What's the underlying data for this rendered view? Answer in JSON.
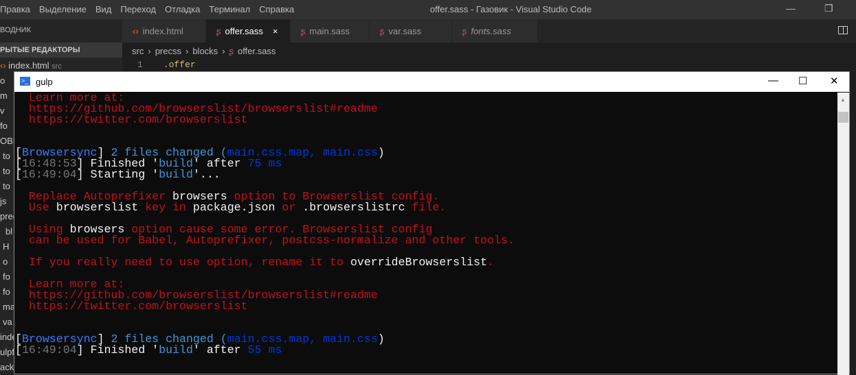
{
  "window": {
    "title": "offer.sass - Газовик - Visual Studio Code",
    "minimize": "—",
    "restore": "❐"
  },
  "menu": [
    "Правка",
    "Выделение",
    "Вид",
    "Переход",
    "Отладка",
    "Терминал",
    "Справка"
  ],
  "sidebar": {
    "header": "ВОДНИК",
    "section": "РЫТЫЕ РЕДАКТОРЫ",
    "open_editor": "index.html",
    "open_editor_dir": "src",
    "fragments": [
      "o",
      "m",
      "v",
      "fo",
      "ОВИ",
      "to",
      "to",
      "to",
      "js",
      "prec",
      "bl",
      "H",
      "o",
      "fo",
      "fo",
      "ma",
      "va",
      "inde",
      "ulpf",
      "ackage-lock.json"
    ]
  },
  "tabs": [
    {
      "label": "index.html",
      "icon": "html-icon"
    },
    {
      "label": "offer.sass",
      "icon": "sass-icon",
      "active": true,
      "close": "×"
    },
    {
      "label": "main.sass",
      "icon": "sass-icon"
    },
    {
      "label": "var.sass",
      "icon": "sass-icon"
    },
    {
      "label": "fonts.sass",
      "icon": "sass-icon",
      "italic": true
    }
  ],
  "breadcrumb": [
    "src",
    "precss",
    "blocks",
    "offer.sass"
  ],
  "editor": {
    "line_number": "1",
    "code": ".offer"
  },
  "terminal": {
    "title": "gulp",
    "minimize": "—",
    "maximize": "☐",
    "close": "✕",
    "lines": [
      [
        [
          "  Learn more at:",
          "red"
        ]
      ],
      [
        [
          "  https://github.com/browserslist/browserslist#readme",
          "red"
        ]
      ],
      [
        [
          "  https://twitter.com/browserslist",
          "red"
        ]
      ],
      [],
      [],
      [
        [
          "[",
          "white"
        ],
        [
          "Browsersync",
          "blue"
        ],
        [
          "] ",
          "white"
        ],
        [
          "2 files changed (",
          "lblue"
        ],
        [
          "main.css.map, main.css",
          "dblue"
        ],
        [
          ")",
          "white"
        ]
      ],
      [
        [
          "[",
          "white"
        ],
        [
          "16:48:53",
          "gray"
        ],
        [
          "] Finished '",
          "white"
        ],
        [
          "build",
          "lblue"
        ],
        [
          "' after ",
          "white"
        ],
        [
          "75 ms",
          "dblue"
        ]
      ],
      [
        [
          "[",
          "white"
        ],
        [
          "16:49:04",
          "gray"
        ],
        [
          "] Starting '",
          "white"
        ],
        [
          "build",
          "lblue"
        ],
        [
          "'...",
          "white"
        ]
      ],
      [],
      [
        [
          "  Replace Autoprefixer ",
          "red"
        ],
        [
          "browsers",
          "white"
        ],
        [
          " option to Browserslist config.",
          "red"
        ]
      ],
      [
        [
          "  Use ",
          "red"
        ],
        [
          "browserslist",
          "white"
        ],
        [
          " key in ",
          "red"
        ],
        [
          "package.json",
          "white"
        ],
        [
          " or ",
          "red"
        ],
        [
          ".browserslistrc",
          "white"
        ],
        [
          " file.",
          "red"
        ]
      ],
      [],
      [
        [
          "  Using ",
          "red"
        ],
        [
          "browsers",
          "white"
        ],
        [
          " option cause some error. Browserslist config",
          "red"
        ]
      ],
      [
        [
          "  can be used for Babel, Autoprefixer, postcss-normalize and other tools.",
          "red"
        ]
      ],
      [],
      [
        [
          "  If you really need to use option, rename it to ",
          "red"
        ],
        [
          "overrideBrowserslist",
          "white"
        ],
        [
          ".",
          "red"
        ]
      ],
      [],
      [
        [
          "  Learn more at:",
          "red"
        ]
      ],
      [
        [
          "  https://github.com/browserslist/browserslist#readme",
          "red"
        ]
      ],
      [
        [
          "  https://twitter.com/browserslist",
          "red"
        ]
      ],
      [],
      [],
      [
        [
          "[",
          "white"
        ],
        [
          "Browsersync",
          "blue"
        ],
        [
          "] ",
          "white"
        ],
        [
          "2 files changed (",
          "lblue"
        ],
        [
          "main.css.map, main.css",
          "dblue"
        ],
        [
          ")",
          "white"
        ]
      ],
      [
        [
          "[",
          "white"
        ],
        [
          "16:49:04",
          "gray"
        ],
        [
          "] Finished '",
          "white"
        ],
        [
          "build",
          "lblue"
        ],
        [
          "' after ",
          "white"
        ],
        [
          "55 ms",
          "dblue"
        ]
      ]
    ]
  }
}
